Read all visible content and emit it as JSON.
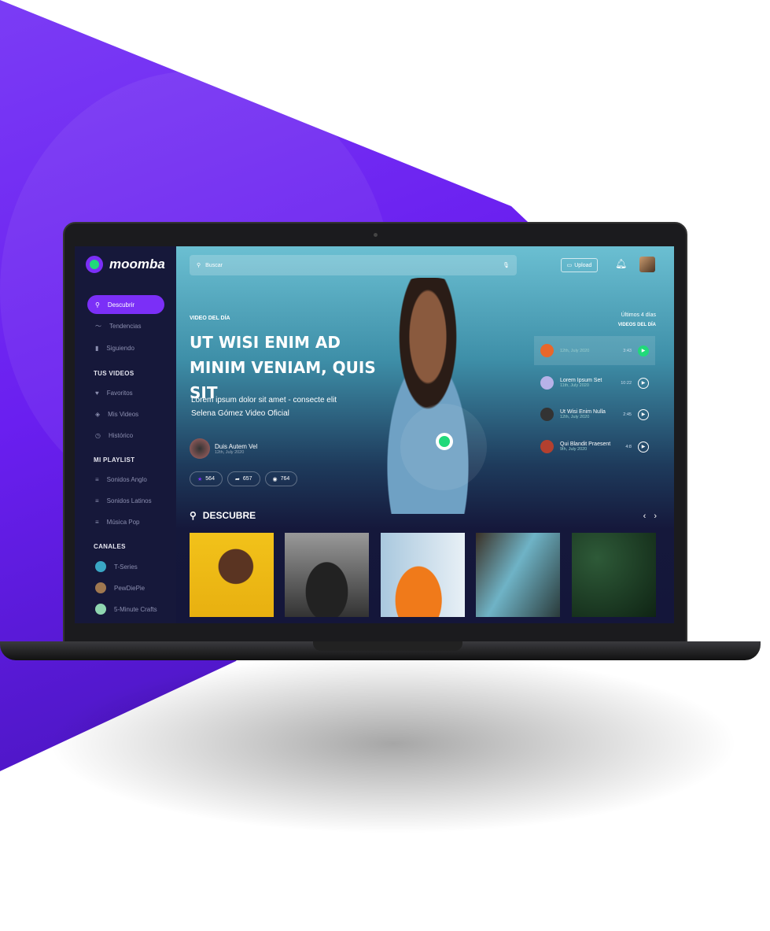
{
  "brand": {
    "name": "moomba"
  },
  "sidebar": {
    "nav": [
      {
        "label": "Descubrir",
        "icon": "search-icon"
      },
      {
        "label": "Tendencias",
        "icon": "trend-icon"
      },
      {
        "label": "Siguiendo",
        "icon": "bookmark-icon"
      }
    ],
    "tus_videos_title": "TUS VIDEOS",
    "tus_videos": [
      {
        "label": "Favoritos",
        "icon": "heart-icon"
      },
      {
        "label": "Mis Videos",
        "icon": "layers-icon"
      },
      {
        "label": "Histórico",
        "icon": "history-icon"
      }
    ],
    "playlist_title": "MI PLAYLIST",
    "playlist": [
      {
        "label": "Sonidos Anglo"
      },
      {
        "label": "Sonidos Latinos"
      },
      {
        "label": "Música Pop"
      }
    ],
    "canales_title": "CANALES",
    "canales": [
      {
        "label": "T-Series",
        "color": "#3aa6c4"
      },
      {
        "label": "PewDiePie",
        "color": "#a07850"
      },
      {
        "label": "5-Minute Crafts",
        "color": "#8fd6b0"
      }
    ]
  },
  "header": {
    "search_placeholder": "Buscar",
    "upload_label": "Upload"
  },
  "hero": {
    "kicker": "VIDEO DEL DÍA",
    "title": "UT WISI ENIM AD MINIM VENIAM, QUIS SIT",
    "desc1": "Lorem ipsum dolor sit amet - consecte elit",
    "desc2": "Selena Gómez Video Oficial",
    "author": "Duis Autem Vel",
    "date": "12th, July 2020",
    "stars": "564",
    "shares": "657",
    "views": "764"
  },
  "videos_panel": {
    "period": "Últimos 4 días",
    "title": "VIDEOS DEL DÍA",
    "items": [
      {
        "title": "",
        "date": "12th, July 2020",
        "duration": "3:43",
        "color": "#e8672b"
      },
      {
        "title": "Lorem Ipsum Set",
        "date": "11th, July 2020",
        "duration": "10:22",
        "color": "#b7b2e8"
      },
      {
        "title": "Ut Wisi Enim Nulla",
        "date": "12th, July 2020",
        "duration": "2:45",
        "color": "#333"
      },
      {
        "title": "Qui Blandit Praesent",
        "date": "9th, July 2020",
        "duration": "4:8",
        "color": "#b3402f"
      }
    ]
  },
  "discover": {
    "title": "DESCUBRE"
  }
}
